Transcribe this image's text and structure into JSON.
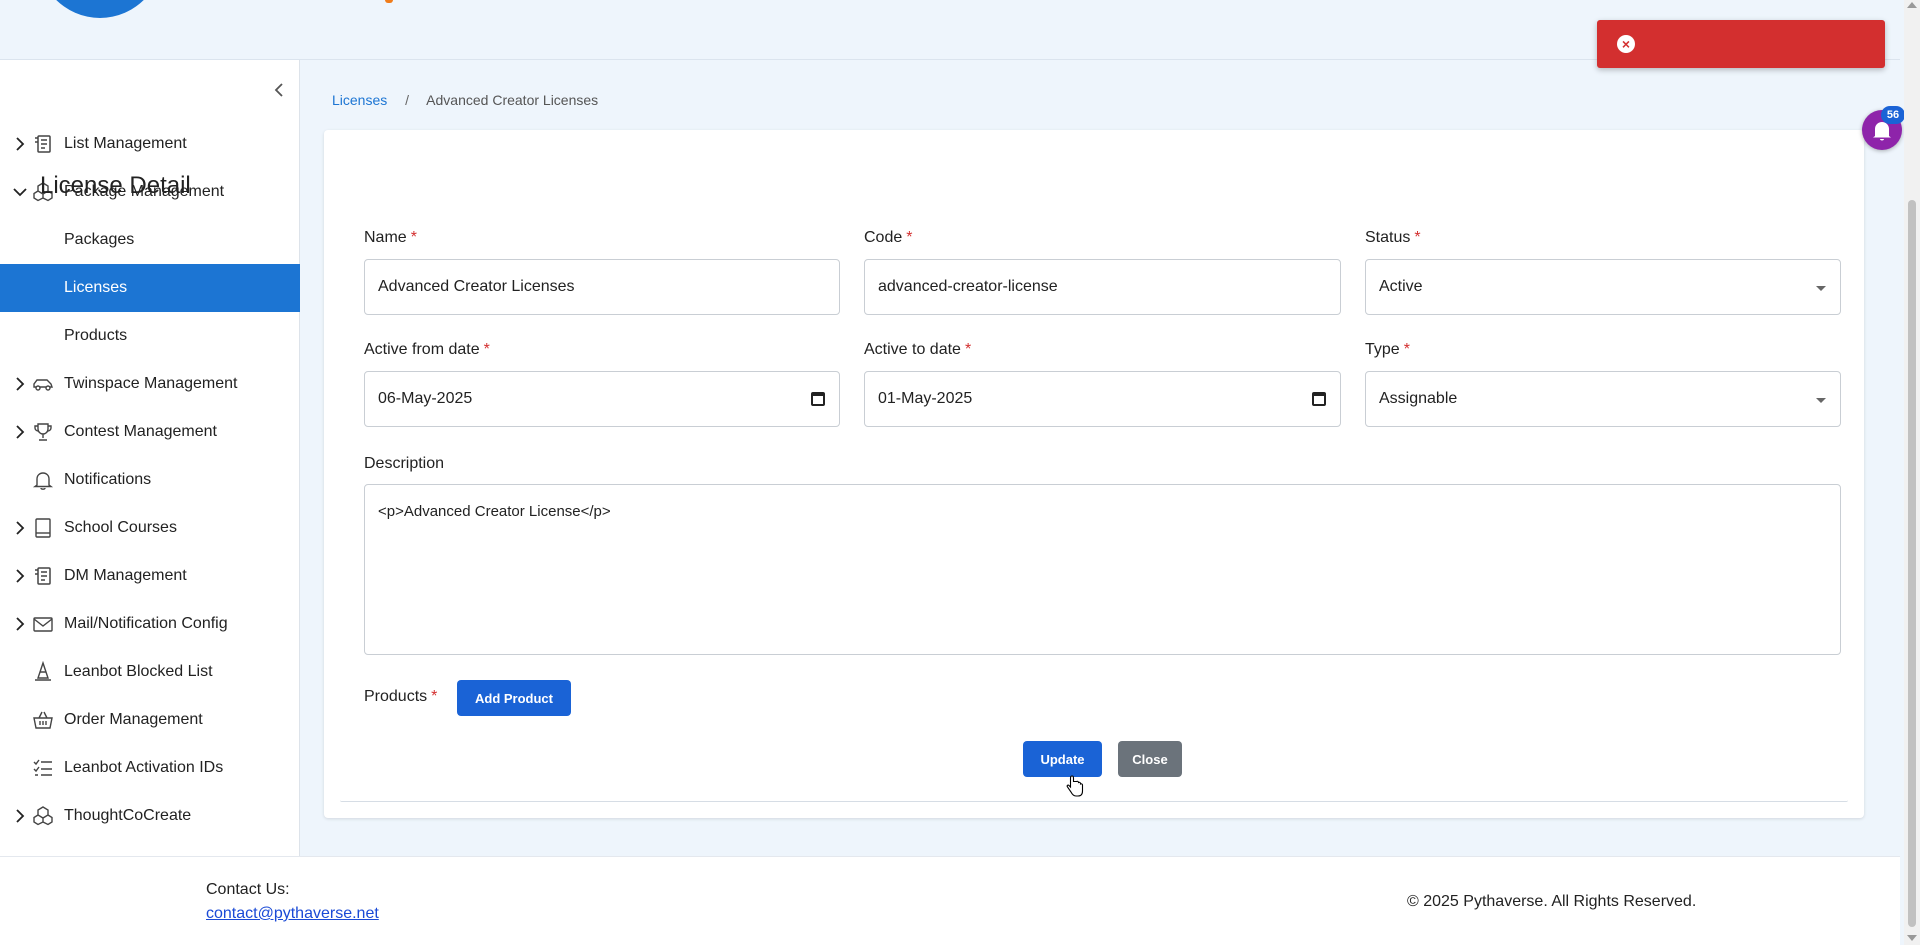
{
  "toast": {
    "icon": "error-circle-icon",
    "color": "#d32f2f"
  },
  "sidebar": {
    "items": [
      {
        "label": "List Management",
        "icon": "list-management-icon",
        "expandable": true,
        "expanded": false
      },
      {
        "label": "Package Management",
        "icon": "package-icon",
        "expandable": true,
        "expanded": true
      },
      {
        "label": "Packages",
        "sub": true
      },
      {
        "label": "Licenses",
        "sub": true,
        "active": true
      },
      {
        "label": "Products",
        "sub": true
      },
      {
        "label": "Twinspace Management",
        "icon": "car-icon",
        "expandable": true,
        "expanded": false
      },
      {
        "label": "Contest Management",
        "icon": "trophy-icon",
        "expandable": true,
        "expanded": false
      },
      {
        "label": "Notifications",
        "icon": "bell-outline-icon",
        "expandable": false
      },
      {
        "label": "School Courses",
        "icon": "book-icon",
        "expandable": true,
        "expanded": false
      },
      {
        "label": "DM Management",
        "icon": "list-management-icon",
        "expandable": true,
        "expanded": false
      },
      {
        "label": "Mail/Notification Config",
        "icon": "mail-icon",
        "expandable": true,
        "expanded": false
      },
      {
        "label": "Leanbot Blocked List",
        "icon": "cone-icon",
        "expandable": false
      },
      {
        "label": "Order Management",
        "icon": "basket-icon",
        "expandable": false
      },
      {
        "label": "Leanbot Activation IDs",
        "icon": "checklist-icon",
        "expandable": false
      },
      {
        "label": "ThoughtCoCreate",
        "icon": "package-icon",
        "expandable": true,
        "expanded": false
      }
    ]
  },
  "breadcrumb": {
    "parent": "Licenses",
    "separator": "/",
    "current": "Advanced Creator Licenses"
  },
  "form": {
    "title": "License Detail",
    "name": {
      "label": "Name",
      "value": "Advanced Creator Licenses"
    },
    "code": {
      "label": "Code",
      "value": "advanced-creator-license"
    },
    "status": {
      "label": "Status",
      "value": "Active"
    },
    "active_from": {
      "label": "Active from date",
      "value": "06-May-2025"
    },
    "active_to": {
      "label": "Active to date",
      "value": "01-May-2025"
    },
    "type": {
      "label": "Type",
      "value": "Assignable"
    },
    "description": {
      "label": "Description",
      "value": "<p>Advanced Creator License</p>"
    },
    "products": {
      "label": "Products",
      "add_label": "Add Product"
    },
    "required_mark": "*",
    "update_label": "Update",
    "close_label": "Close"
  },
  "notifications": {
    "badge": "56",
    "color": "#8e24aa"
  },
  "footer": {
    "contact_label": "Contact Us:",
    "contact_email": "contact@pythaverse.net",
    "copyright": "© 2025 Pythaverse. All Rights Reserved."
  },
  "colors": {
    "accent": "#1c75d3",
    "primary_button": "#1a63d6",
    "secondary_button": "#6b737b",
    "required": "#d32f2f"
  }
}
